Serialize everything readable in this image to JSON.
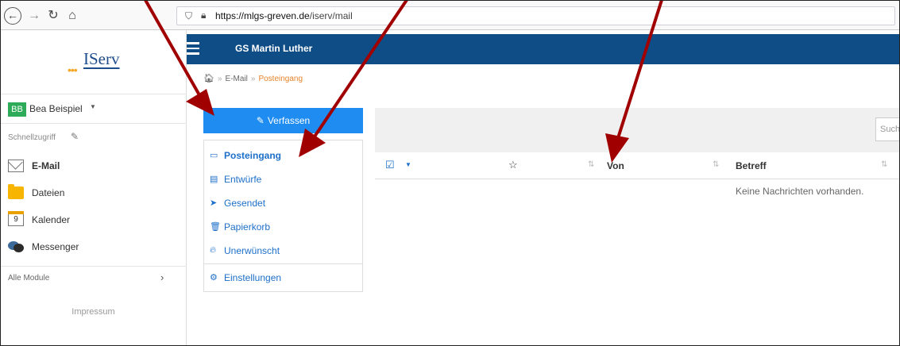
{
  "browser": {
    "url_host": "https://mlgs-greven.de",
    "url_path": "/iserv/mail",
    "back_icon": "arrow-left-icon",
    "forward_icon": "arrow-right-icon",
    "reload_icon": "reload-icon",
    "home_icon": "home-icon"
  },
  "sidebar": {
    "logo_text": "IServ",
    "user": {
      "initials": "BB",
      "name": "Bea Beispiel"
    },
    "quick_access_label": "Schnellzugriff",
    "items": [
      {
        "label": "E-Mail",
        "icon": "mail-icon"
      },
      {
        "label": "Dateien",
        "icon": "folder-icon"
      },
      {
        "label": "Kalender",
        "icon": "calendar-icon",
        "day": "9"
      },
      {
        "label": "Messenger",
        "icon": "chat-icon"
      }
    ],
    "all_modules_label": "Alle Module",
    "impressum_label": "Impressum"
  },
  "header": {
    "title": "GS Martin Luther"
  },
  "breadcrumb": {
    "mail": "E-Mail",
    "current": "Posteingang"
  },
  "mail": {
    "compose_label": "Verfassen",
    "folders": [
      {
        "label": "Posteingang",
        "icon": "inbox-icon"
      },
      {
        "label": "Entwürfe",
        "icon": "drafts-icon"
      },
      {
        "label": "Gesendet",
        "icon": "sent-icon"
      },
      {
        "label": "Papierkorb",
        "icon": "trash-icon"
      },
      {
        "label": "Unerwünscht",
        "icon": "spam-icon"
      }
    ],
    "settings_label": "Einstellungen",
    "search_placeholder": "Suche",
    "columns": {
      "from": "Von",
      "subject": "Betreff"
    },
    "empty_message": "Keine Nachrichten vorhanden."
  },
  "colors": {
    "header": "#0f4d87",
    "compose": "#1e8cf0",
    "link": "#1d6fc9",
    "avatar": "#2eab59",
    "breadcrumb_current": "#e8832a",
    "arrow": "#a00000"
  }
}
